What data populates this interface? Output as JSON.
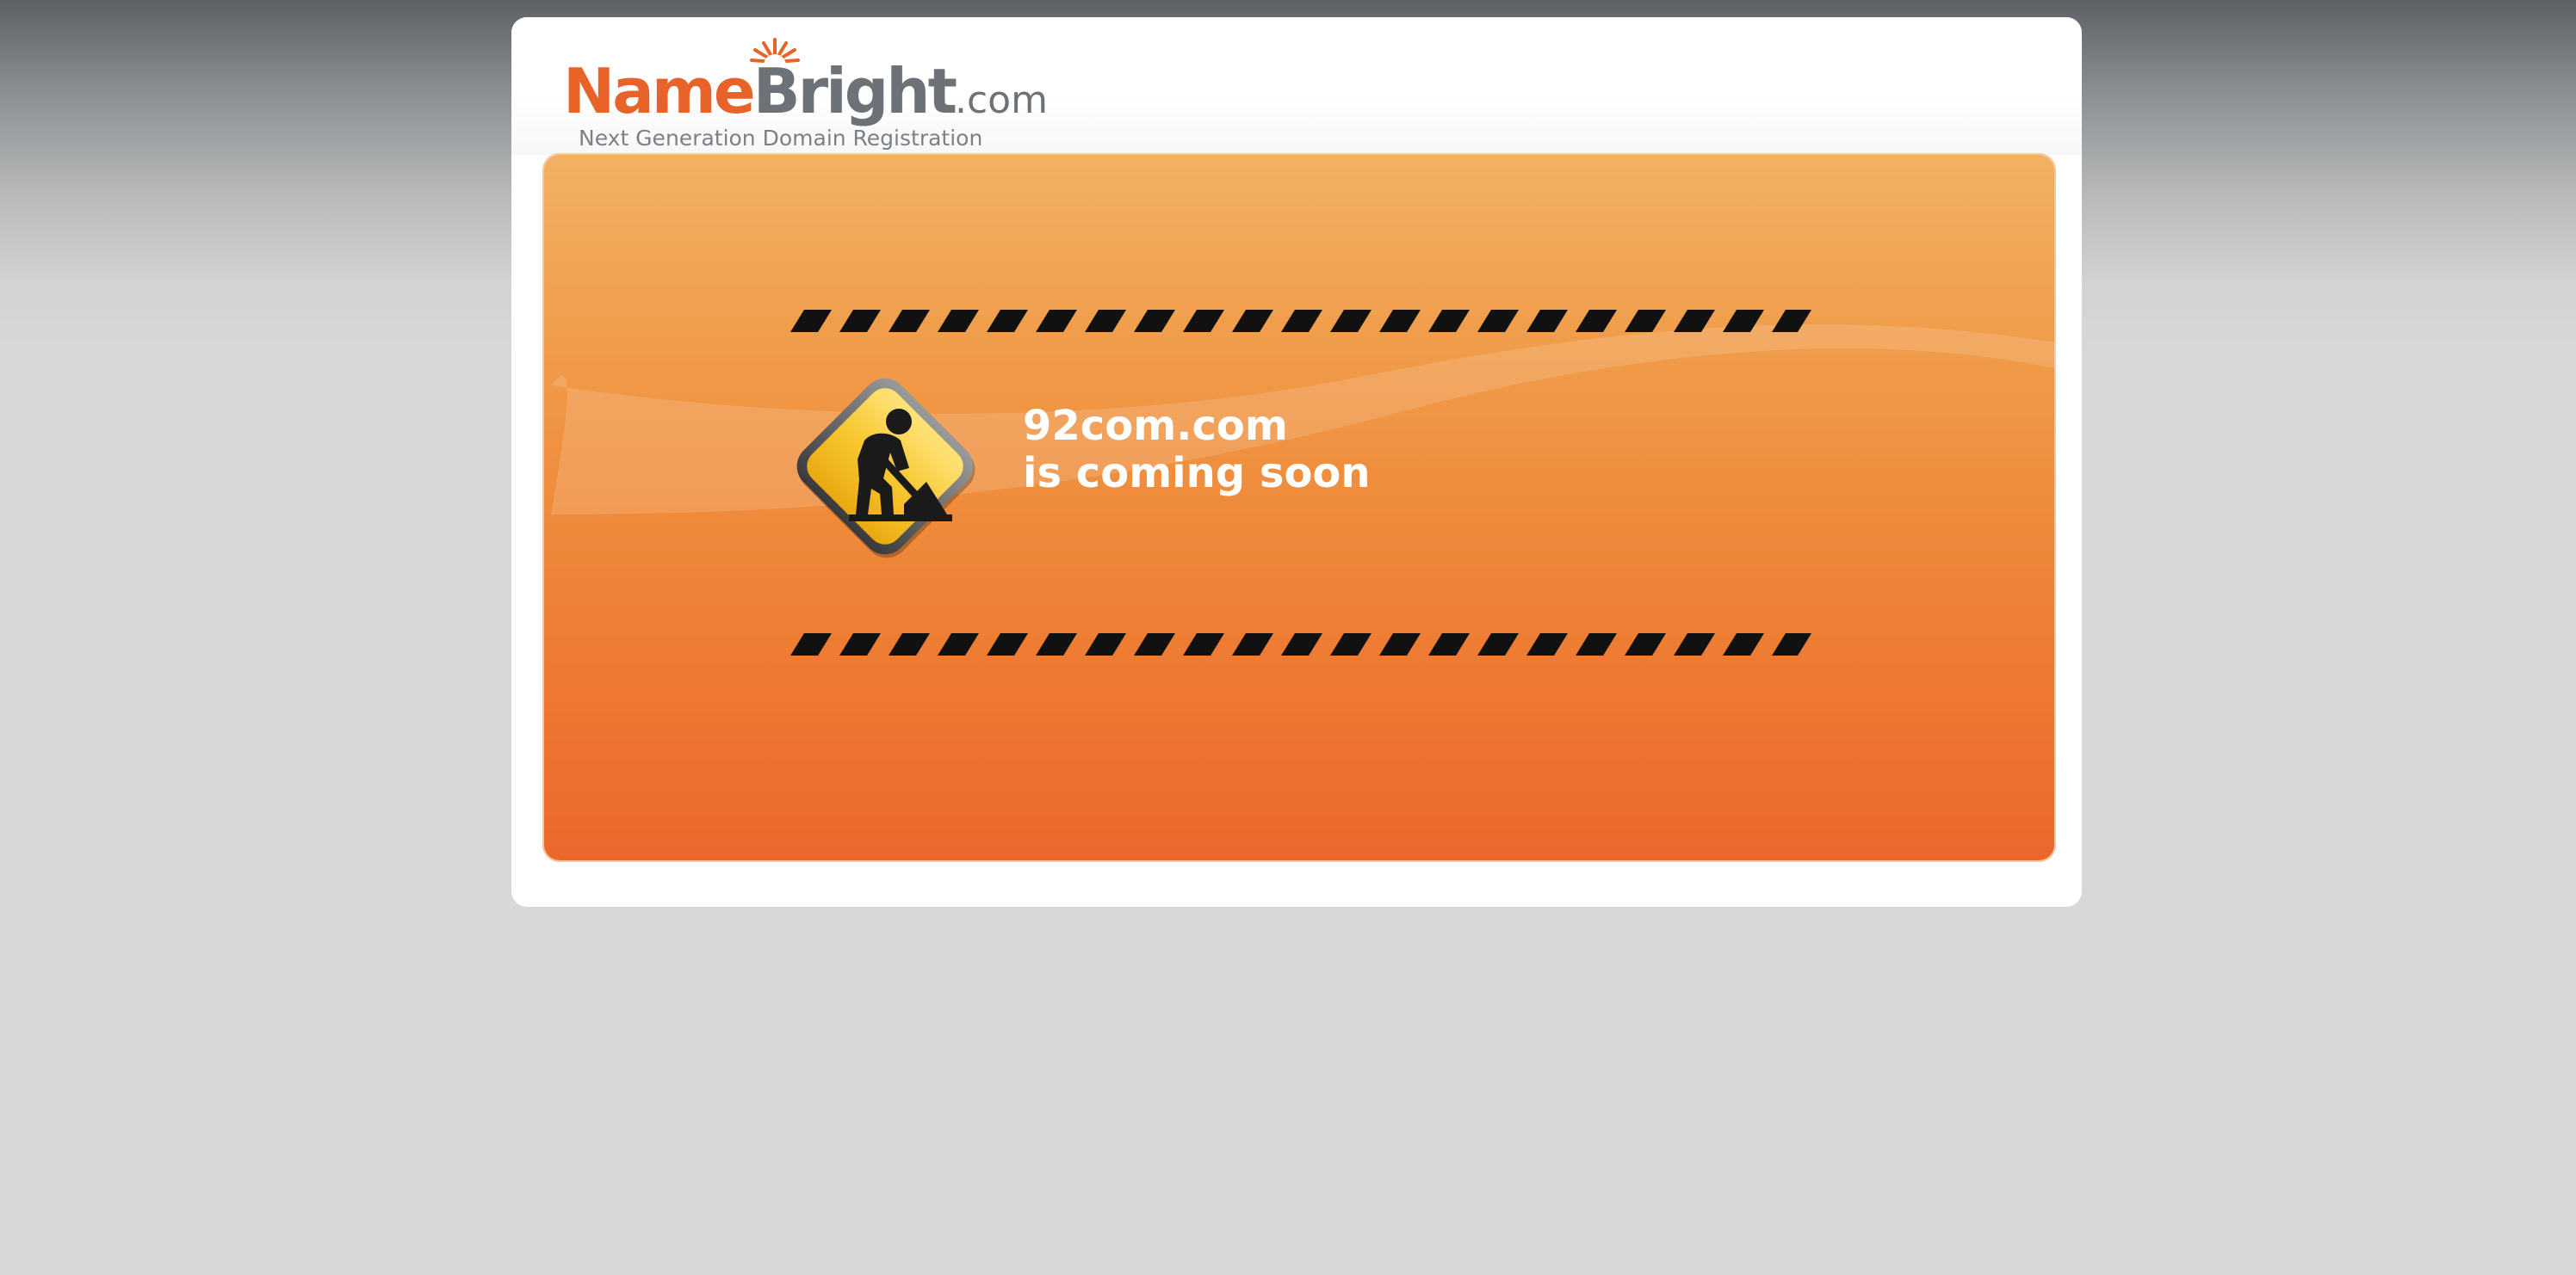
{
  "brand": {
    "logo_name": "Name",
    "logo_bright": "Bright",
    "logo_tld": ".com",
    "tagline": "Next Generation Domain Registration",
    "colors": {
      "orange": "#e8632a",
      "gray": "#6c7278"
    }
  },
  "parking": {
    "domain": "92com.com",
    "status": "is coming soon",
    "icon": "construction-worker-icon",
    "panel_color": "#ee7c33"
  }
}
